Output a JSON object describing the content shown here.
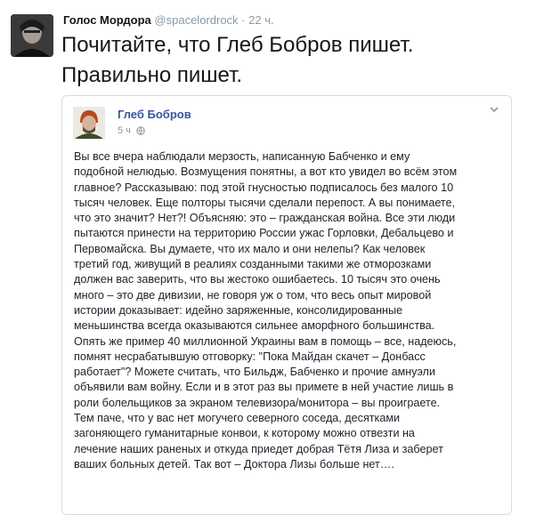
{
  "tweet": {
    "author_name": "Голос Мордора",
    "author_handle": "@spacelordrock",
    "separator": "·",
    "time": "22 ч.",
    "text_line1": "Почитайте, что Глеб Бобров пишет.",
    "text_line2": "Правильно пишет."
  },
  "quote": {
    "author_name": "Глеб Бобров",
    "time": "5 ч",
    "body": "Вы все вчера наблюдали мерзость, написанную Бабченко и ему\nподобной нелюдью. Возмущения понятны, а вот кто увидел во всём этом\nглавное? Рассказываю: под этой гнусностью подписалось без малого 10\nтысяч человек. Еще полторы тысячи сделали перепост. А вы понимаете,\nчто это значит? Нет?! Объясняю: это – гражданская война. Все эти люди\nпытаются принести на территорию России ужас Горловки, Дебальцево и\nПервомайска. Вы думаете, что их мало и они нелепы? Как человек\nтретий год, живущий в реалиях созданными такими же отморозками\nдолжен вас заверить, что вы жестоко ошибаетесь. 10 тысяч это очень\nмного – это две дивизии, не говоря уж о том, что весь опыт мировой\nистории доказывает: идейно заряженные, консолидированные\nменьшинства всегда оказываются сильнее аморфного большинства.\nОпять же пример 40 миллионной Украины вам в помощь – все, надеюсь,\nпомнят несрабатывшую отговорку: \"Пока Майдан скачет – Донбасс\nработает\"? Можете считать, что Бильдж, Бабченко и прочие амнуэли\nобъявили вам войну. Если и в этот раз вы примете в ней участие лишь в\nроли болельщиков за экраном телевизора/монитора – вы проиграете.\nТем паче, что у вас нет могучего северного соседа, десятками\nзагоняющего гуманитарные конвои, к которому можно отвезти на\nлечение наших раненых и откуда приедет добрая Тётя Лиза и заберет\nваших больных детей. Так вот – Доктора Лизы больше нет…."
  },
  "icons": {
    "tweet_avatar": "user-avatar-photo",
    "quote_avatar": "user-avatar-photo",
    "privacy": "globe-icon",
    "menu": "chevron-down-icon"
  },
  "colors": {
    "fb_name": "#365899",
    "muted": "#8899a6",
    "card_border": "#d7dce1"
  }
}
